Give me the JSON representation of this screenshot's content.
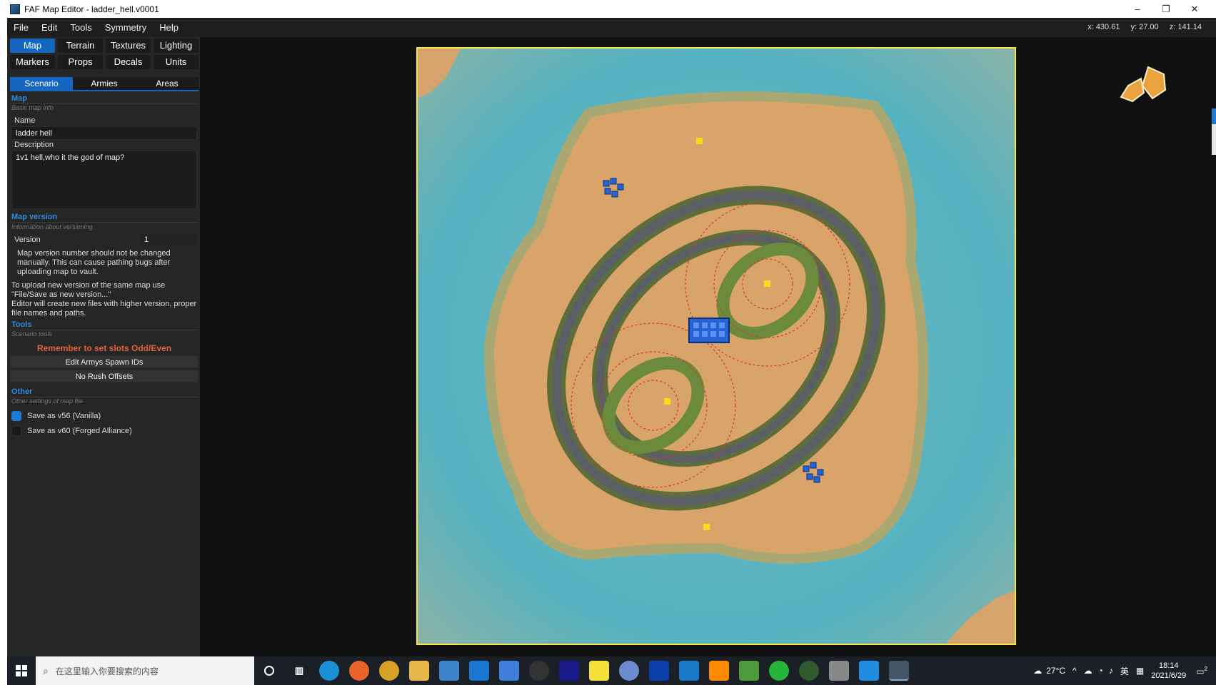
{
  "window": {
    "title": "FAF Map Editor - ladder_hell.v0001",
    "minimize_glyph": "–",
    "restore_glyph": "❐",
    "close_glyph": "✕"
  },
  "menu": [
    "File",
    "Edit",
    "Tools",
    "Symmetry",
    "Help"
  ],
  "coords": {
    "x": "x: 430.61",
    "y": "y: 27.00",
    "z": "z: 141.14"
  },
  "main_tabs_row1": [
    "Map",
    "Terrain",
    "Textures",
    "Lighting"
  ],
  "main_tabs_row2": [
    "Markers",
    "Props",
    "Decals",
    "Units"
  ],
  "sub_tabs": [
    "Scenario",
    "Armies",
    "Areas"
  ],
  "map_section": {
    "title": "Map",
    "subtitle": "Basic map info",
    "name_label": "Name",
    "name_value": "ladder hell",
    "description_label": "Description",
    "description_value": "1v1 hell,who it the god of map?"
  },
  "version_section": {
    "title": "Map version",
    "subtitle": "Information about versioning",
    "version_label": "Version",
    "version_value": "1",
    "note1": "Map version number should not be changed manually. This can cause pathing bugs after uploading map to vault.",
    "note2": "To upload new version of the same map use \"File/Save as new version...\"\nEditor will create new files with higher version, proper file names and paths."
  },
  "tools_section": {
    "title": "Tools",
    "subtitle": "Scenario tools",
    "warning": "Remember to set slots Odd/Even",
    "button1": "Edit Armys Spawn IDs",
    "button2": "No Rush Offsets"
  },
  "other_section": {
    "title": "Other",
    "subtitle": "Other settings of map file",
    "check1_label": "Save as v56 (Vanilla)",
    "check1_checked": true,
    "check2_label": "Save as v60 (Forged Alliance)",
    "check2_checked": false
  },
  "taskbar": {
    "search_placeholder": "在这里输入你要搜索的内容",
    "temperature": "27°C",
    "ime": "英",
    "time": "18:14",
    "date": "2021/6/29",
    "notification_count": "2"
  },
  "colors": {
    "accent": "#1566c0",
    "warning": "#e3613b",
    "map_border": "#f5e64a"
  }
}
